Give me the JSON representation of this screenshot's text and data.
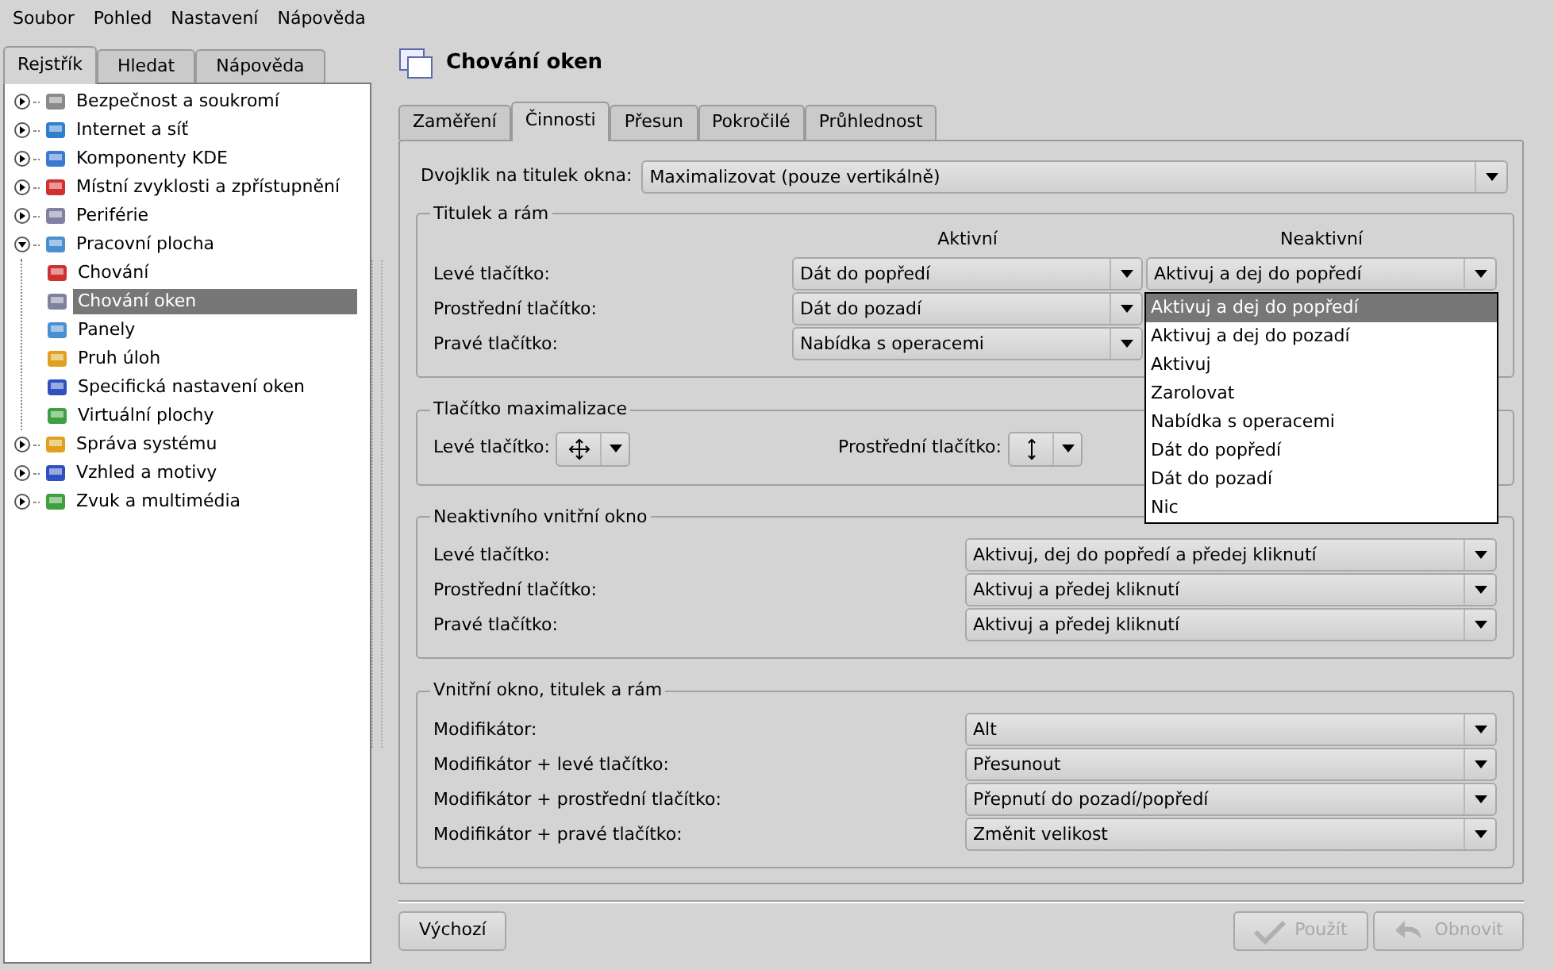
{
  "menu": [
    "Soubor",
    "Pohled",
    "Nastavení",
    "Nápověda"
  ],
  "sidebar": {
    "tabs": [
      {
        "label": "Rejstřík",
        "selected": true
      },
      {
        "label": "Hledat",
        "selected": false
      },
      {
        "label": "Nápověda",
        "selected": false
      }
    ],
    "tree": [
      {
        "label": "Bezpečnost a soukromí",
        "expanded": false,
        "selected": false
      },
      {
        "label": "Internet a síť",
        "expanded": false,
        "selected": false
      },
      {
        "label": "Komponenty KDE",
        "expanded": false,
        "selected": false
      },
      {
        "label": "Místní zvyklosti a zpřístupnění",
        "expanded": false,
        "selected": false
      },
      {
        "label": "Periférie",
        "expanded": false,
        "selected": false
      },
      {
        "label": "Pracovní plocha",
        "expanded": true,
        "selected": false,
        "children": [
          {
            "label": "Chování",
            "selected": false
          },
          {
            "label": "Chování oken",
            "selected": true
          },
          {
            "label": "Panely",
            "selected": false
          },
          {
            "label": "Pruh úloh",
            "selected": false
          },
          {
            "label": "Specifická nastavení oken",
            "selected": false
          },
          {
            "label": "Virtuální plochy",
            "selected": false
          }
        ]
      },
      {
        "label": "Správa systému",
        "expanded": false,
        "selected": false
      },
      {
        "label": "Vzhled a motivy",
        "expanded": false,
        "selected": false
      },
      {
        "label": "Zvuk a multimédia",
        "expanded": false,
        "selected": false
      }
    ]
  },
  "page": {
    "title": "Chování oken",
    "tabs": [
      {
        "label": "Zaměření",
        "selected": false
      },
      {
        "label": "Činnosti",
        "selected": true
      },
      {
        "label": "Přesun",
        "selected": false
      },
      {
        "label": "Pokročilé",
        "selected": false
      },
      {
        "label": "Průhlednost",
        "selected": false
      }
    ],
    "double_click": {
      "label": "Dvojklik na titulek okna:",
      "value": "Maximalizovat (pouze vertikálně)"
    },
    "groups": [
      {
        "title": "Titulek a rám",
        "kind": "two_column",
        "columns": [
          "Aktivní",
          "Neaktivní"
        ],
        "rows": [
          {
            "label": "Levé tlačítko:",
            "values": [
              "Dát do popředí",
              "Aktivuj a dej do popředí"
            ]
          },
          {
            "label": "Prostřední tlačítko:",
            "values": [
              "Dát do pozadí"
            ]
          },
          {
            "label": "Pravé tlačítko:",
            "values": [
              "Nabídka s operacemi"
            ]
          }
        ]
      },
      {
        "title": "Tlačítko maximalizace",
        "kind": "icon_buttons",
        "rows": [
          {
            "label": "Levé tlačítko:"
          },
          {
            "label": "Prostřední tlačítko:"
          }
        ]
      },
      {
        "title": "Neaktivního vnitřní okno",
        "kind": "single",
        "rows": [
          {
            "label": "Levé tlačítko:",
            "value": "Aktivuj, dej do popředí a předej kliknutí"
          },
          {
            "label": "Prostřední tlačítko:",
            "value": "Aktivuj a předej kliknutí"
          },
          {
            "label": "Pravé tlačítko:",
            "value": "Aktivuj a předej kliknutí"
          }
        ]
      },
      {
        "title": "Vnitřní okno, titulek a rám",
        "kind": "single",
        "rows": [
          {
            "label": "Modifikátor:",
            "value": "Alt"
          },
          {
            "label": "Modifikátor + levé tlačítko:",
            "value": "Přesunout"
          },
          {
            "label": "Modifikátor + prostřední tlačítko:",
            "value": "Přepnutí do pozadí/popředí"
          },
          {
            "label": "Modifikátor + pravé tlačítko:",
            "value": "Změnit velikost"
          }
        ]
      }
    ],
    "open_dropdown": {
      "items": [
        {
          "label": "Aktivuj a dej do popředí",
          "selected": true
        },
        {
          "label": "Aktivuj a dej do pozadí",
          "selected": false
        },
        {
          "label": "Aktivuj",
          "selected": false
        },
        {
          "label": "Zarolovat",
          "selected": false
        },
        {
          "label": "Nabídka s operacemi",
          "selected": false
        },
        {
          "label": "Dát do popředí",
          "selected": false
        },
        {
          "label": "Dát do pozadí",
          "selected": false
        },
        {
          "label": "Nic",
          "selected": false
        }
      ]
    },
    "buttons": [
      {
        "label": "Výchozí",
        "disabled": false
      },
      {
        "label": "Použít",
        "disabled": true
      },
      {
        "label": "Obnovit",
        "disabled": true
      }
    ]
  }
}
